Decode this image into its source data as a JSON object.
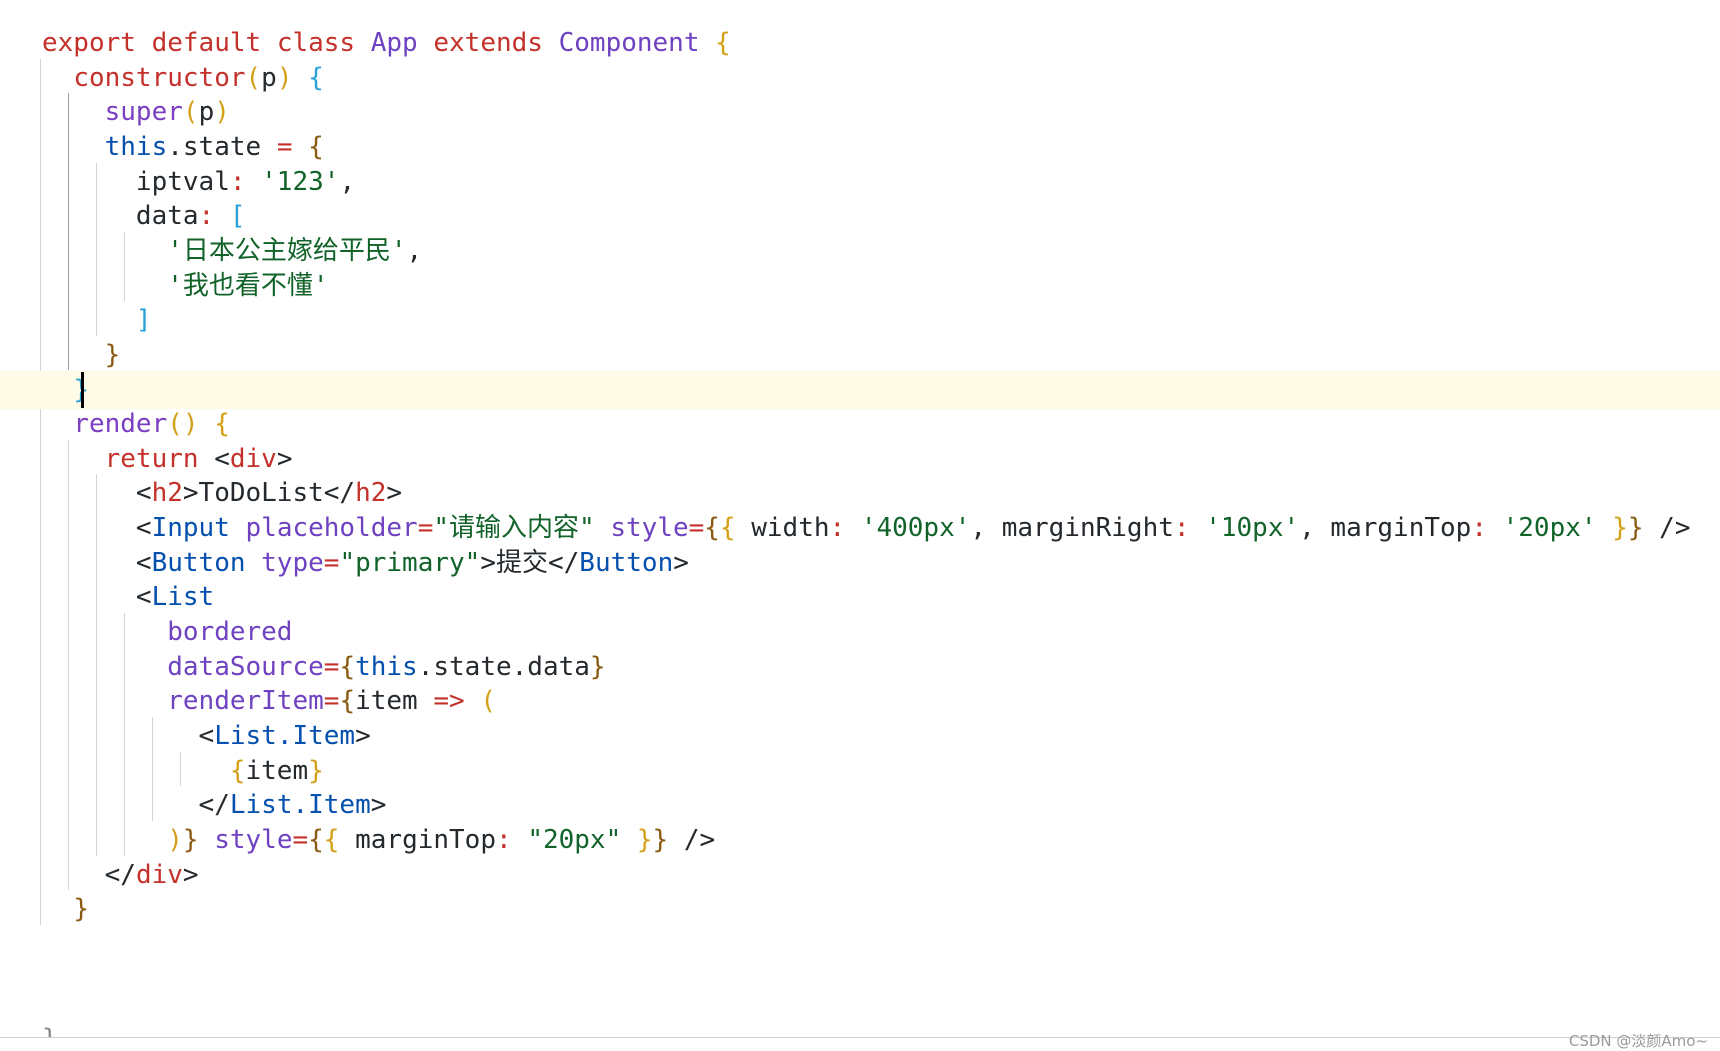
{
  "colors": {
    "keyword": "#c4312b",
    "class_name": "#6f42c1",
    "function": "#7b3fc2",
    "this_keyword": "#0550ae",
    "jsx_tag": "#0550ae",
    "attribute": "#6f42c1",
    "string": "#116329",
    "operator": "#c4312b",
    "plain": "#24292e",
    "bracket_gold": "#d4a017",
    "bracket_brown": "#8a5a12",
    "bracket_blue": "#29a0d8",
    "current_line": "#fefbe6"
  },
  "editor": {
    "current_line_index": 10,
    "truncated_last_line": "}",
    "watermark": "CSDN @淡颜Amo~",
    "lines": [
      {
        "tokens": [
          {
            "t": "export",
            "c": "keyword"
          },
          {
            "t": " "
          },
          {
            "t": "default",
            "c": "keyword"
          },
          {
            "t": " "
          },
          {
            "t": "class",
            "c": "keyword"
          },
          {
            "t": " "
          },
          {
            "t": "App",
            "c": "class_name"
          },
          {
            "t": " "
          },
          {
            "t": "extends",
            "c": "keyword"
          },
          {
            "t": " "
          },
          {
            "t": "Component",
            "c": "class_name"
          },
          {
            "t": " "
          },
          {
            "t": "{",
            "c": "bracket_gold"
          }
        ]
      },
      {
        "tokens": [
          {
            "t": "  "
          },
          {
            "t": "constructor",
            "c": "keyword"
          },
          {
            "t": "(",
            "c": "bracket_gold"
          },
          {
            "t": "p",
            "c": "plain"
          },
          {
            "t": ")",
            "c": "bracket_gold"
          },
          {
            "t": " "
          },
          {
            "t": "{",
            "c": "bracket_blue"
          }
        ]
      },
      {
        "tokens": [
          {
            "t": "    "
          },
          {
            "t": "super",
            "c": "function"
          },
          {
            "t": "(",
            "c": "bracket_gold"
          },
          {
            "t": "p",
            "c": "plain"
          },
          {
            "t": ")",
            "c": "bracket_gold"
          }
        ]
      },
      {
        "tokens": [
          {
            "t": "    "
          },
          {
            "t": "this",
            "c": "this_keyword"
          },
          {
            "t": ".state ",
            "c": "plain"
          },
          {
            "t": "=",
            "c": "operator"
          },
          {
            "t": " "
          },
          {
            "t": "{",
            "c": "bracket_brown"
          }
        ]
      },
      {
        "tokens": [
          {
            "t": "      "
          },
          {
            "t": "iptval",
            "c": "plain"
          },
          {
            "t": ": ",
            "c": "operator"
          },
          {
            "t": "'123'",
            "c": "string"
          },
          {
            "t": ",",
            "c": "plain"
          }
        ]
      },
      {
        "tokens": [
          {
            "t": "      "
          },
          {
            "t": "data",
            "c": "plain"
          },
          {
            "t": ": ",
            "c": "operator"
          },
          {
            "t": "[",
            "c": "bracket_blue"
          }
        ]
      },
      {
        "tokens": [
          {
            "t": "        "
          },
          {
            "t": "'日本公主嫁给平民'",
            "c": "string"
          },
          {
            "t": ",",
            "c": "plain"
          }
        ]
      },
      {
        "tokens": [
          {
            "t": "        "
          },
          {
            "t": "'我也看不懂'",
            "c": "string"
          }
        ]
      },
      {
        "tokens": [
          {
            "t": "      "
          },
          {
            "t": "]",
            "c": "bracket_blue"
          }
        ]
      },
      {
        "tokens": [
          {
            "t": "    "
          },
          {
            "t": "}",
            "c": "bracket_brown"
          }
        ]
      },
      {
        "tokens": [
          {
            "t": "  "
          },
          {
            "t": "}",
            "c": "bracket_blue"
          }
        ]
      },
      {
        "tokens": [
          {
            "t": "  "
          },
          {
            "t": "render",
            "c": "function"
          },
          {
            "t": "()",
            "c": "bracket_gold"
          },
          {
            "t": " "
          },
          {
            "t": "{",
            "c": "bracket_gold"
          }
        ]
      },
      {
        "tokens": [
          {
            "t": "    "
          },
          {
            "t": "return",
            "c": "keyword"
          },
          {
            "t": " "
          },
          {
            "t": "<",
            "c": "plain"
          },
          {
            "t": "div",
            "c": "keyword"
          },
          {
            "t": ">",
            "c": "plain"
          }
        ]
      },
      {
        "tokens": [
          {
            "t": "      "
          },
          {
            "t": "<",
            "c": "plain"
          },
          {
            "t": "h2",
            "c": "keyword"
          },
          {
            "t": ">ToDoList</",
            "c": "plain"
          },
          {
            "t": "h2",
            "c": "keyword"
          },
          {
            "t": ">",
            "c": "plain"
          }
        ]
      },
      {
        "tokens": [
          {
            "t": "      "
          },
          {
            "t": "<",
            "c": "plain"
          },
          {
            "t": "Input",
            "c": "jsx_tag"
          },
          {
            "t": " "
          },
          {
            "t": "placeholder",
            "c": "attribute"
          },
          {
            "t": "=",
            "c": "operator"
          },
          {
            "t": "\"请输入内容\"",
            "c": "string"
          },
          {
            "t": " "
          },
          {
            "t": "style",
            "c": "attribute"
          },
          {
            "t": "=",
            "c": "operator"
          },
          {
            "t": "{",
            "c": "bracket_brown"
          },
          {
            "t": "{",
            "c": "bracket_gold"
          },
          {
            "t": " width",
            "c": "plain"
          },
          {
            "t": ": ",
            "c": "operator"
          },
          {
            "t": "'400px'",
            "c": "string"
          },
          {
            "t": ", marginRight",
            "c": "plain"
          },
          {
            "t": ": ",
            "c": "operator"
          },
          {
            "t": "'10px'",
            "c": "string"
          },
          {
            "t": ", marginTop",
            "c": "plain"
          },
          {
            "t": ": ",
            "c": "operator"
          },
          {
            "t": "'20px'",
            "c": "string"
          },
          {
            "t": " "
          },
          {
            "t": "}",
            "c": "bracket_gold"
          },
          {
            "t": "}",
            "c": "bracket_brown"
          },
          {
            "t": " />",
            "c": "plain"
          }
        ]
      },
      {
        "tokens": [
          {
            "t": "      "
          },
          {
            "t": "<",
            "c": "plain"
          },
          {
            "t": "Button",
            "c": "jsx_tag"
          },
          {
            "t": " "
          },
          {
            "t": "type",
            "c": "attribute"
          },
          {
            "t": "=",
            "c": "operator"
          },
          {
            "t": "\"primary\"",
            "c": "string"
          },
          {
            "t": ">提交</",
            "c": "plain"
          },
          {
            "t": "Button",
            "c": "jsx_tag"
          },
          {
            "t": ">",
            "c": "plain"
          }
        ]
      },
      {
        "tokens": [
          {
            "t": "      "
          },
          {
            "t": "<",
            "c": "plain"
          },
          {
            "t": "List",
            "c": "jsx_tag"
          }
        ]
      },
      {
        "tokens": [
          {
            "t": "        "
          },
          {
            "t": "bordered",
            "c": "attribute"
          }
        ]
      },
      {
        "tokens": [
          {
            "t": "        "
          },
          {
            "t": "dataSource",
            "c": "attribute"
          },
          {
            "t": "=",
            "c": "operator"
          },
          {
            "t": "{",
            "c": "bracket_brown"
          },
          {
            "t": "this",
            "c": "this_keyword"
          },
          {
            "t": ".state.data",
            "c": "plain"
          },
          {
            "t": "}",
            "c": "bracket_brown"
          }
        ]
      },
      {
        "tokens": [
          {
            "t": "        "
          },
          {
            "t": "renderItem",
            "c": "attribute"
          },
          {
            "t": "=",
            "c": "operator"
          },
          {
            "t": "{",
            "c": "bracket_brown"
          },
          {
            "t": "item",
            "c": "plain"
          },
          {
            "t": " "
          },
          {
            "t": "=>",
            "c": "operator"
          },
          {
            "t": " "
          },
          {
            "t": "(",
            "c": "bracket_gold"
          }
        ]
      },
      {
        "tokens": [
          {
            "t": "          "
          },
          {
            "t": "<",
            "c": "plain"
          },
          {
            "t": "List.Item",
            "c": "jsx_tag"
          },
          {
            "t": ">",
            "c": "plain"
          }
        ]
      },
      {
        "tokens": [
          {
            "t": "            "
          },
          {
            "t": "{",
            "c": "bracket_gold"
          },
          {
            "t": "item",
            "c": "plain"
          },
          {
            "t": "}",
            "c": "bracket_gold"
          }
        ]
      },
      {
        "tokens": [
          {
            "t": "          "
          },
          {
            "t": "</",
            "c": "plain"
          },
          {
            "t": "List.Item",
            "c": "jsx_tag"
          },
          {
            "t": ">",
            "c": "plain"
          }
        ]
      },
      {
        "tokens": [
          {
            "t": "        "
          },
          {
            "t": ")",
            "c": "bracket_gold"
          },
          {
            "t": "}",
            "c": "bracket_brown"
          },
          {
            "t": " "
          },
          {
            "t": "style",
            "c": "attribute"
          },
          {
            "t": "=",
            "c": "operator"
          },
          {
            "t": "{",
            "c": "bracket_brown"
          },
          {
            "t": "{",
            "c": "bracket_gold"
          },
          {
            "t": " marginTop",
            "c": "plain"
          },
          {
            "t": ": ",
            "c": "operator"
          },
          {
            "t": "\"20px\"",
            "c": "string"
          },
          {
            "t": " "
          },
          {
            "t": "}",
            "c": "bracket_gold"
          },
          {
            "t": "}",
            "c": "bracket_brown"
          },
          {
            "t": " />",
            "c": "plain"
          }
        ]
      },
      {
        "tokens": [
          {
            "t": "    "
          },
          {
            "t": "</",
            "c": "plain"
          },
          {
            "t": "div",
            "c": "keyword"
          },
          {
            "t": ">",
            "c": "plain"
          }
        ]
      },
      {
        "tokens": [
          {
            "t": "  "
          },
          {
            "t": "}",
            "c": "bracket_brown"
          }
        ]
      }
    ]
  }
}
